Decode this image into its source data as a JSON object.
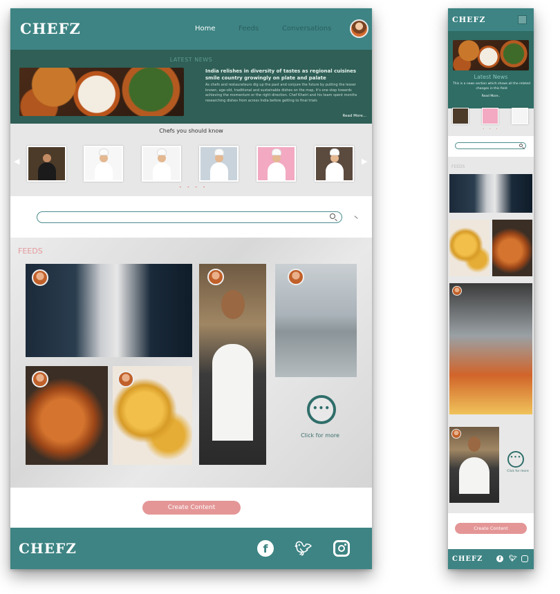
{
  "brand": {
    "name": "CHEFZ"
  },
  "colors": {
    "teal": "#3e8484",
    "dark_teal": "#2f5f56",
    "accent_pink": "#e49696",
    "feeds_label": "#e5999b"
  },
  "desktop": {
    "nav": {
      "home": "Home",
      "feeds": "Feeds",
      "conversations": "Conversations"
    },
    "news": {
      "label": "LATEST NEWS",
      "headline": "India relishes in diversity of tastes as regional cuisines smile country growingly on plate and palate",
      "body": "As chefs and restaurateurs dig up the past and conjure the future by putting the lesser known, age-old, traditional and sustainable dishes on the map, it's one step towards achieving the momentum or the right direction. Chef Khatri and his team spent months researching dishes from across India before getting to final trials",
      "read_more": "Read More..."
    },
    "chefs": {
      "title": "Chefs you should know",
      "dots": "• • • •"
    },
    "feeds": {
      "label": "FEEDS",
      "more_label": "Click for more",
      "more_dots": "•••"
    },
    "create_button": "Create Content"
  },
  "mobile": {
    "news": {
      "label": "Latest News",
      "body": "This is a news section which shows all the related changes in this field",
      "read_more": "Read More.."
    },
    "chefs_dots": "• • •",
    "feeds_label": "FEEDS",
    "more_label": "Click for more",
    "more_dots": "•••",
    "create_button": "Create Content"
  },
  "icons": {
    "profile": "avatar",
    "search": "search-icon",
    "filter": "filter-icon",
    "prev": "chevron-left-icon",
    "next": "chevron-right-icon",
    "more": "more-dots-icon",
    "facebook": "facebook-icon",
    "twitter": "twitter-icon",
    "instagram": "instagram-icon",
    "menu": "menu-icon"
  }
}
